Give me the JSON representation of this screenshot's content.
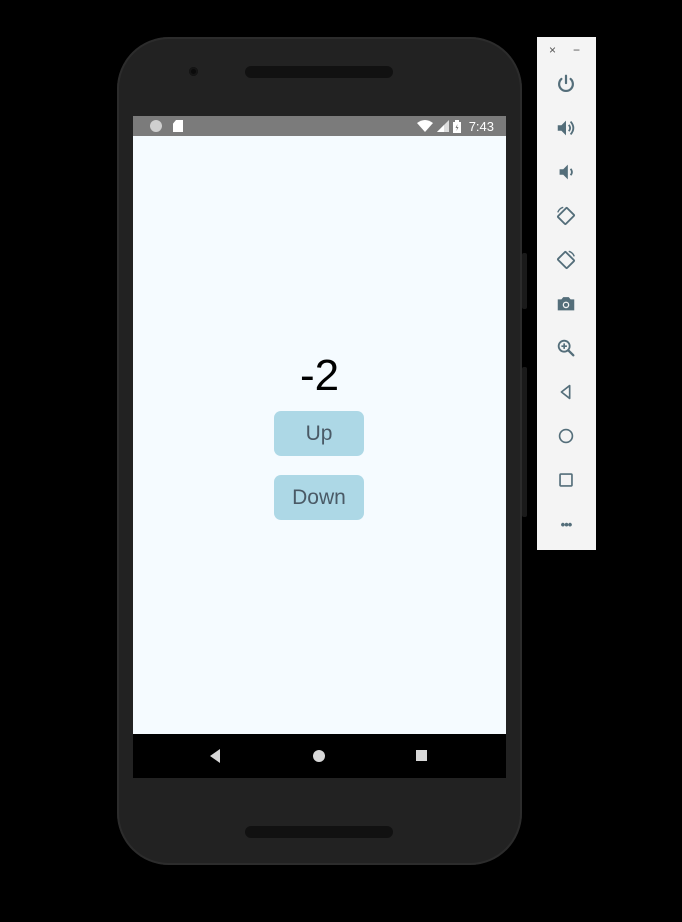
{
  "statusbar": {
    "time": "7:43"
  },
  "app": {
    "counter_value": "-2",
    "up_label": "Up",
    "down_label": "Down"
  },
  "emulator_toolbar": {
    "close_label": "×",
    "minimize_label": "−",
    "more_label": "•••",
    "tools": [
      "power-icon",
      "volume-up-icon",
      "volume-down-icon",
      "rotate-left-icon",
      "rotate-right-icon",
      "camera-icon",
      "zoom-icon",
      "back-icon",
      "home-icon",
      "overview-icon",
      "more-icon"
    ]
  },
  "colors": {
    "screen_bg": "#f5fbff",
    "button_bg": "#add8e6",
    "button_text": "#4a5a66",
    "statusbar_bg": "#7b7b7b",
    "toolbar_bg": "#f4f4f4",
    "toolbar_icon": "#546e7a"
  }
}
